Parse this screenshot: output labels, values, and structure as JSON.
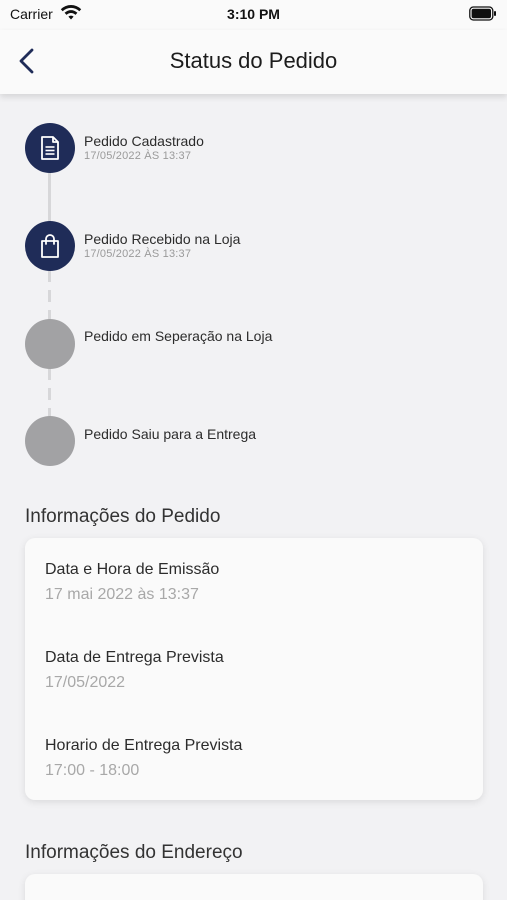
{
  "status_bar": {
    "carrier": "Carrier",
    "time": "3:10 PM"
  },
  "nav": {
    "title": "Status do Pedido"
  },
  "timeline": {
    "steps": [
      {
        "label": "Pedido Cadastrado",
        "date": "17/05/2022 ÀS 13:37",
        "state": "done",
        "icon": "document-icon"
      },
      {
        "label": "Pedido Recebido na Loja",
        "date": "17/05/2022 ÀS 13:37",
        "state": "done",
        "icon": "shopping-bag-icon"
      },
      {
        "label": "Pedido em Seperação na Loja",
        "state": "pending"
      },
      {
        "label": "Pedido Saiu para a Entrega",
        "state": "pending"
      }
    ]
  },
  "order_info": {
    "title": "Informações do Pedido",
    "items": [
      {
        "label": "Data e Hora de Emissão",
        "value": " 17 mai 2022 às 13:37"
      },
      {
        "label": "Data de Entrega Prevista",
        "value": "17/05/2022"
      },
      {
        "label": "Horario de Entrega Prevista",
        "value": "17:00 - 18:00"
      }
    ]
  },
  "address_info": {
    "title": "Informações do Endereço"
  },
  "colors": {
    "primary": "#1f2c58",
    "pending": "#a2a2a4",
    "background": "#f2f2f4",
    "card": "#fafafa"
  }
}
